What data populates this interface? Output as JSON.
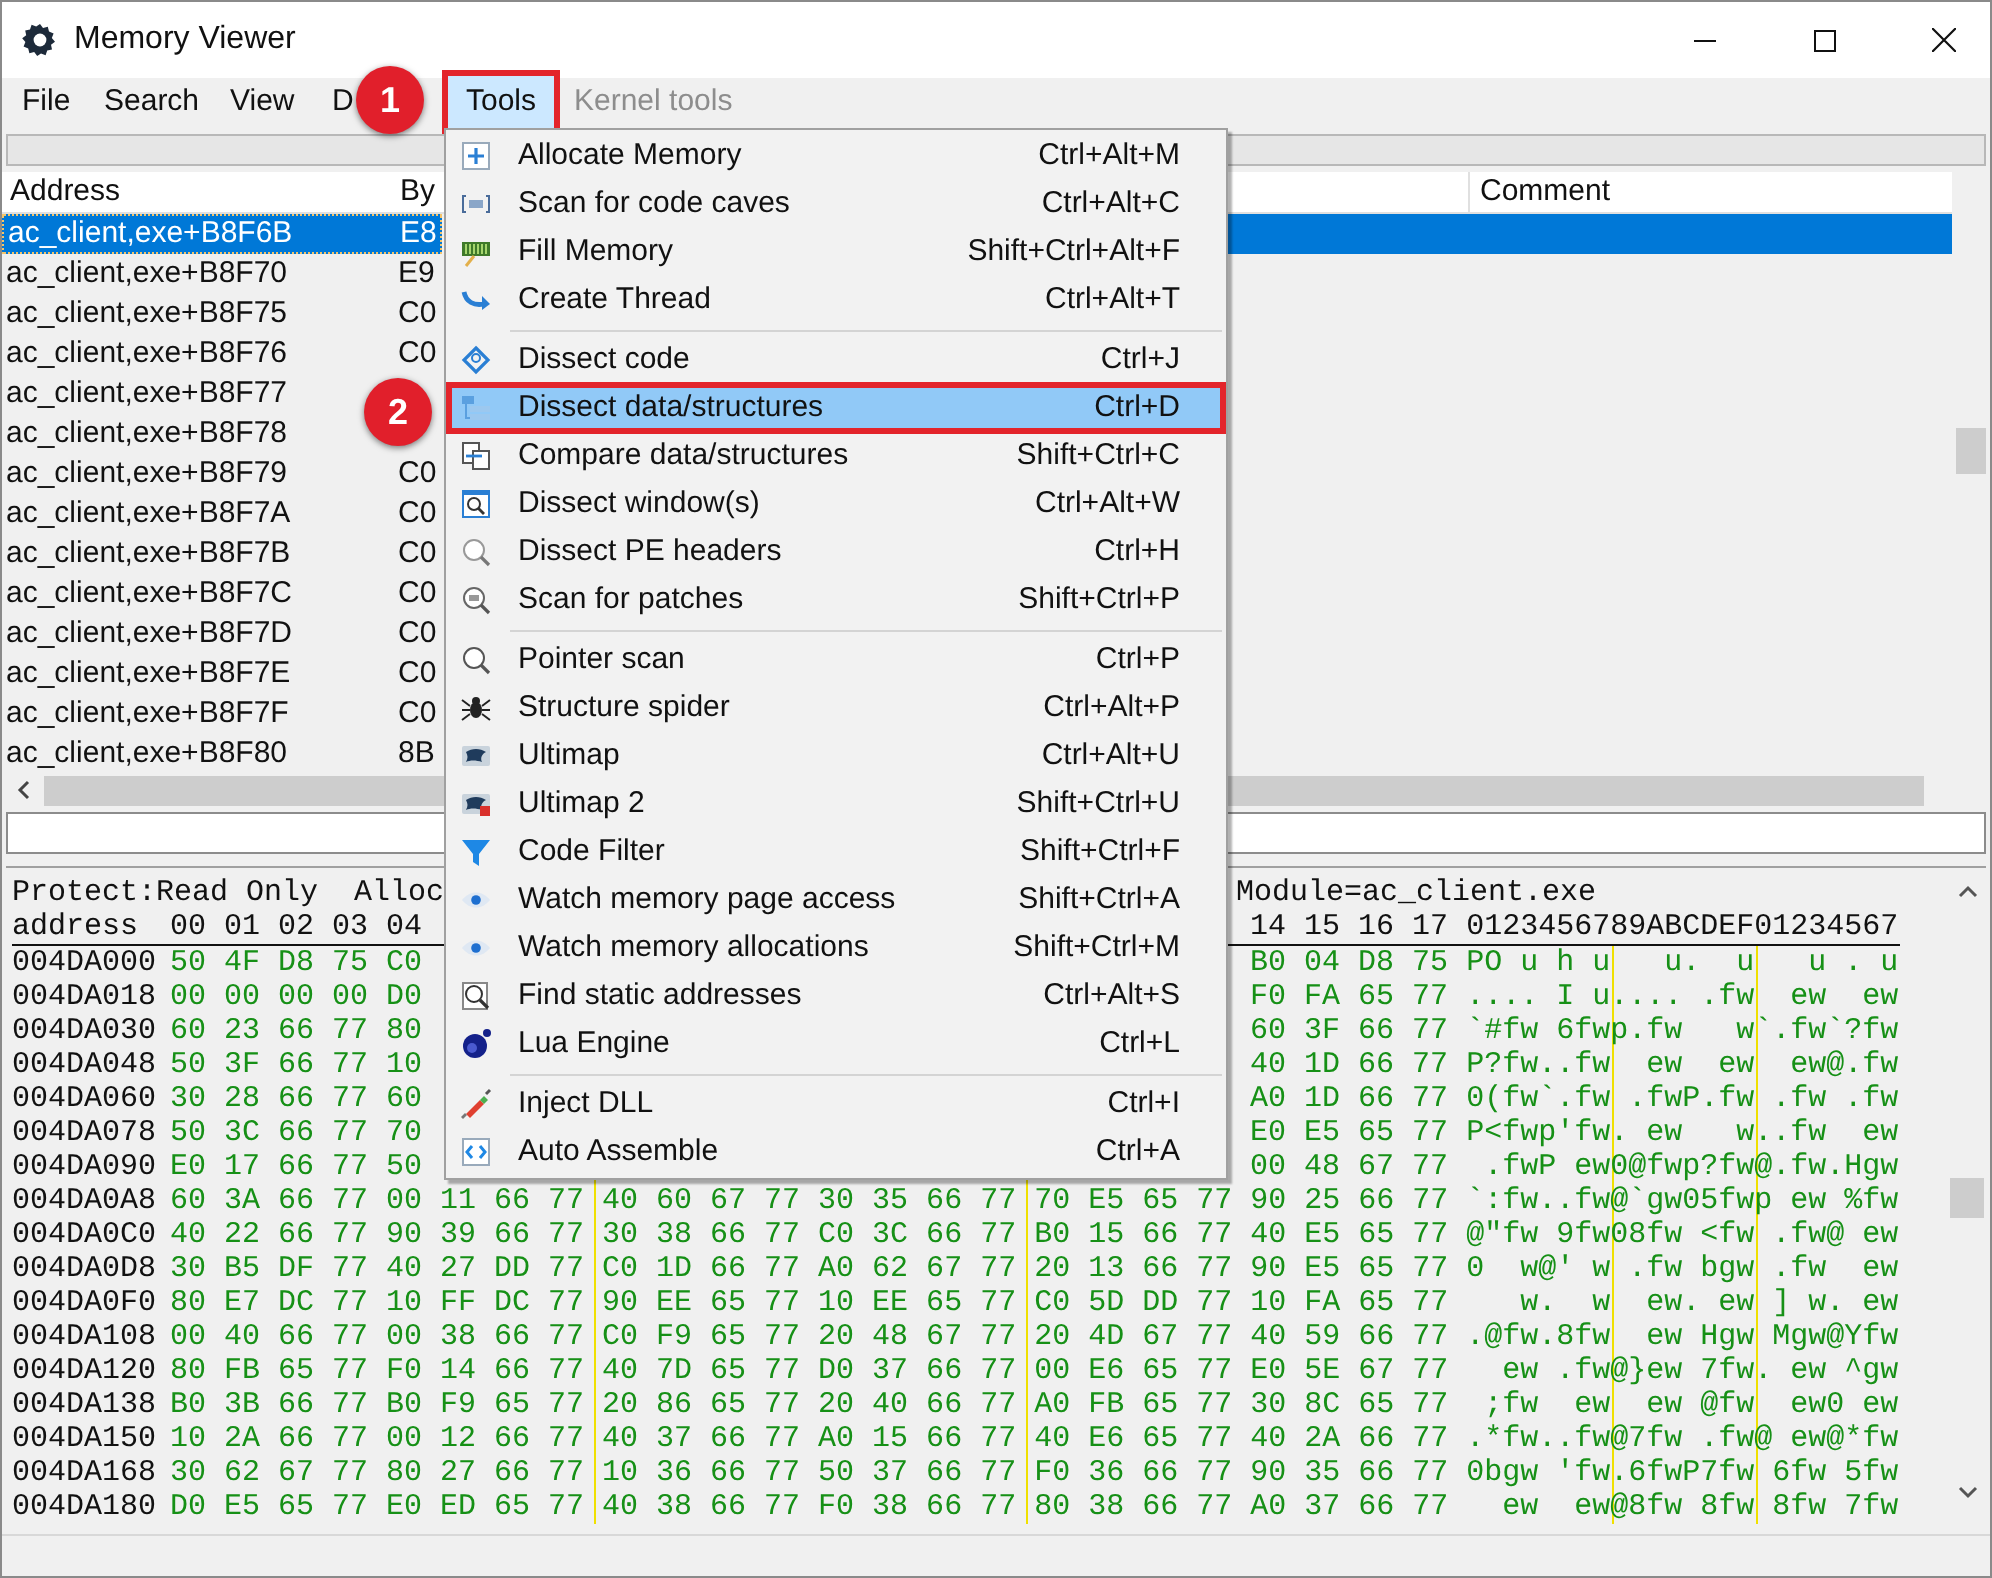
{
  "window": {
    "title": "Memory Viewer"
  },
  "menu_bar": [
    {
      "label": "File",
      "selected": false,
      "disabled": false,
      "outlined": false
    },
    {
      "label": "Search",
      "selected": false,
      "disabled": false,
      "outlined": false
    },
    {
      "label": "View",
      "selected": false,
      "disabled": false,
      "outlined": false
    },
    {
      "label": "D",
      "selected": false,
      "disabled": false,
      "outlined": false
    },
    {
      "label": "Tools",
      "selected": true,
      "disabled": false,
      "outlined": true
    },
    {
      "label": "Kernel tools",
      "selected": false,
      "disabled": true,
      "outlined": false
    }
  ],
  "tools_menu": {
    "sections": [
      {
        "items": [
          {
            "label": "Allocate Memory",
            "shortcut": "Ctrl+Alt+M",
            "selected": false,
            "outlined": false
          },
          {
            "label": "Scan for code caves",
            "shortcut": "Ctrl+Alt+C",
            "selected": false,
            "outlined": false
          },
          {
            "label": "Fill Memory",
            "shortcut": "Shift+Ctrl+Alt+F",
            "selected": false,
            "outlined": false
          },
          {
            "label": "Create Thread",
            "shortcut": "Ctrl+Alt+T",
            "selected": false,
            "outlined": false
          }
        ]
      },
      {
        "items": [
          {
            "label": "Dissect code",
            "shortcut": "Ctrl+J",
            "selected": false,
            "outlined": false
          },
          {
            "label": "Dissect data/structures",
            "shortcut": "Ctrl+D",
            "selected": true,
            "outlined": true
          },
          {
            "label": "Compare data/structures",
            "shortcut": "Shift+Ctrl+C",
            "selected": false,
            "outlined": false
          },
          {
            "label": "Dissect window(s)",
            "shortcut": "Ctrl+Alt+W",
            "selected": false,
            "outlined": false
          },
          {
            "label": "Dissect PE headers",
            "shortcut": "Ctrl+H",
            "selected": false,
            "outlined": false
          },
          {
            "label": "Scan for patches",
            "shortcut": "Shift+Ctrl+P",
            "selected": false,
            "outlined": false
          }
        ]
      },
      {
        "items": [
          {
            "label": "Pointer scan",
            "shortcut": "Ctrl+P",
            "selected": false,
            "outlined": false
          },
          {
            "label": "Structure spider",
            "shortcut": "Ctrl+Alt+P",
            "selected": false,
            "outlined": false
          },
          {
            "label": "Ultimap",
            "shortcut": "Ctrl+Alt+U",
            "selected": false,
            "outlined": false
          },
          {
            "label": "Ultimap 2",
            "shortcut": "Shift+Ctrl+U",
            "selected": false,
            "outlined": false
          },
          {
            "label": "Code Filter",
            "shortcut": "Shift+Ctrl+F",
            "selected": false,
            "outlined": false
          },
          {
            "label": "Watch memory page access",
            "shortcut": "Shift+Ctrl+A",
            "selected": false,
            "outlined": false
          },
          {
            "label": "Watch memory allocations",
            "shortcut": "Shift+Ctrl+M",
            "selected": false,
            "outlined": false
          },
          {
            "label": "Find static addresses",
            "shortcut": "Ctrl+Alt+S",
            "selected": false,
            "outlined": false
          },
          {
            "label": "Lua Engine",
            "shortcut": "Ctrl+L",
            "selected": false,
            "outlined": false
          }
        ]
      },
      {
        "items": [
          {
            "label": "Inject DLL",
            "shortcut": "Ctrl+I",
            "selected": false,
            "outlined": false
          },
          {
            "label": "Auto Assemble",
            "shortcut": "Ctrl+A",
            "selected": false,
            "outlined": false
          }
        ]
      }
    ]
  },
  "disassembler": {
    "columns": [
      "Address",
      "By",
      "Comment"
    ],
    "rows": [
      {
        "address": "ac_client,exe+B8F6B",
        "bytes": "E8",
        "selected": true
      },
      {
        "address": "ac_client,exe+B8F70",
        "bytes": "E9",
        "selected": false
      },
      {
        "address": "ac_client,exe+B8F75",
        "bytes": "C0",
        "selected": false
      },
      {
        "address": "ac_client,exe+B8F76",
        "bytes": "C0",
        "selected": false
      },
      {
        "address": "ac_client,exe+B8F77",
        "selected": false
      },
      {
        "address": "ac_client,exe+B8F78",
        "selected": false
      },
      {
        "address": "ac_client,exe+B8F79",
        "bytes": "C0",
        "selected": false
      },
      {
        "address": "ac_client,exe+B8F7A",
        "bytes": "C0",
        "selected": false
      },
      {
        "address": "ac_client,exe+B8F7B",
        "bytes": "C0",
        "selected": false
      },
      {
        "address": "ac_client,exe+B8F7C",
        "bytes": "C0",
        "selected": false
      },
      {
        "address": "ac_client,exe+B8F7D",
        "bytes": "C0",
        "selected": false
      },
      {
        "address": "ac_client,exe+B8F7E",
        "bytes": "C0",
        "selected": false
      },
      {
        "address": "ac_client,exe+B8F7F",
        "bytes": "C0",
        "selected": false
      },
      {
        "address": "ac_client,exe+B8F80",
        "bytes": "8B",
        "selected": false
      }
    ]
  },
  "hex_view": {
    "info_left": "Protect:Read Only  Alloc",
    "info_right": "Module=ac_client.exe",
    "header_label": "address",
    "header_bytes_left": "00 01 02 03 04",
    "header_bytes_right": "14 15 16 17",
    "header_ascii": "0123456789ABCDEF01234567",
    "rows": [
      {
        "kind": "covered",
        "address": "004DA000",
        "bytes_left": "50 4F D8 75 C0",
        "bytes_right": "B0 04 D8 75",
        "ascii": "PO u h u   u.  u   u . u"
      },
      {
        "kind": "covered",
        "address": "004DA018",
        "bytes_left": "00 00 00 00 D0",
        "bytes_right": "F0 FA 65 77",
        "ascii": ".... I u.... .fw  ew  ew"
      },
      {
        "kind": "covered",
        "address": "004DA030",
        "bytes_left": "60 23 66 77 80",
        "bytes_right": "60 3F 66 77",
        "ascii": "`#fw 6fwp.fw   w`.fw`?fw"
      },
      {
        "kind": "covered",
        "address": "004DA048",
        "bytes_left": "50 3F 66 77 10",
        "bytes_right": "40 1D 66 77",
        "ascii": "P?fw..fw  ew  ew  ew@.fw"
      },
      {
        "kind": "covered",
        "address": "004DA060",
        "bytes_left": "30 28 66 77 60",
        "bytes_right": "A0 1D 66 77",
        "ascii": "0(fw`.fw .fwP.fw .fw .fw"
      },
      {
        "kind": "covered",
        "address": "004DA078",
        "bytes_left": "50 3C 66 77 70",
        "bytes_right": "E0 E5 65 77",
        "ascii": "P<fwp'fw. ew   w..fw  ew"
      },
      {
        "kind": "covered",
        "address": "004DA090",
        "bytes_left": "E0 17 66 77 50",
        "bytes_right": "00 48 67 77",
        "ascii": " .fwP ew0@fwp?fw@.fw.Hgw"
      },
      {
        "kind": "full",
        "address": "004DA0A8",
        "bytes": "60 3A 66 77 00 11 66 77 40 60 67 77 30 35 66 77 70 E5 65 77 90 25 66 77",
        "ascii": "`:fw..fw@`gw05fwp ew %fw"
      },
      {
        "kind": "full",
        "address": "004DA0C0",
        "bytes": "40 22 66 77 90 39 66 77 30 38 66 77 C0 3C 66 77 B0 15 66 77 40 E5 65 77",
        "ascii": "@\"fw 9fw08fw <fw .fw@ ew"
      },
      {
        "kind": "full",
        "address": "004DA0D8",
        "bytes": "30 B5 DF 77 40 27 DD 77 C0 1D 66 77 A0 62 67 77 20 13 66 77 90 E5 65 77",
        "ascii": "0  w@' w .fw bgw .fw  ew"
      },
      {
        "kind": "full",
        "address": "004DA0F0",
        "bytes": "80 E7 DC 77 10 FF DC 77 90 EE 65 77 10 EE 65 77 C0 5D DD 77 10 FA 65 77",
        "ascii": "   w.  w  ew. ew ] w. ew"
      },
      {
        "kind": "full",
        "address": "004DA108",
        "bytes": "00 40 66 77 00 38 66 77 C0 F9 65 77 20 48 67 77 20 4D 67 77 40 59 66 77",
        "ascii": ".@fw.8fw  ew Hgw Mgw@Yfw"
      },
      {
        "kind": "full",
        "address": "004DA120",
        "bytes": "80 FB 65 77 F0 14 66 77 40 7D 65 77 D0 37 66 77 00 E6 65 77 E0 5E 67 77",
        "ascii": "  ew .fw@}ew 7fw. ew ^gw"
      },
      {
        "kind": "full",
        "address": "004DA138",
        "bytes": "B0 3B 66 77 B0 F9 65 77 20 86 65 77 20 40 66 77 A0 FB 65 77 30 8C 65 77",
        "ascii": " ;fw  ew  ew @fw  ew0 ew"
      },
      {
        "kind": "full",
        "address": "004DA150",
        "bytes": "10 2A 66 77 00 12 66 77 40 37 66 77 A0 15 66 77 40 E6 65 77 40 2A 66 77",
        "ascii": ".*fw..fw@7fw .fw@ ew@*fw"
      },
      {
        "kind": "full",
        "address": "004DA168",
        "bytes": "30 62 67 77 80 27 66 77 10 36 66 77 50 37 66 77 F0 36 66 77 90 35 66 77",
        "ascii": "0bgw 'fw.6fwP7fw 6fw 5fw"
      },
      {
        "kind": "full",
        "address": "004DA180",
        "bytes": "D0 E5 65 77 E0 ED 65 77 40 38 66 77 F0 38 66 77 80 38 66 77 A0 37 66 77",
        "ascii": "  ew  ew@8fw 8fw 8fw 7fw"
      }
    ]
  },
  "annotations": [
    {
      "label": "1"
    },
    {
      "label": "2"
    }
  ]
}
